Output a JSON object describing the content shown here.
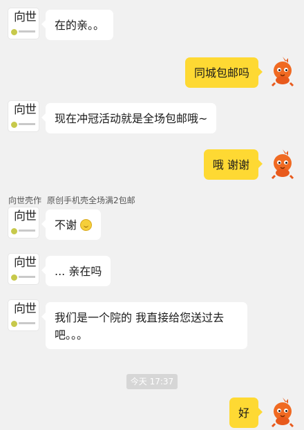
{
  "messages": [
    {
      "id": "m1",
      "side": "left",
      "text": "在的亲。。"
    },
    {
      "id": "m2",
      "side": "right",
      "text": "同城包邮吗"
    },
    {
      "id": "m3",
      "side": "left",
      "text": "现在冲冠活动就是全场包邮哦~"
    },
    {
      "id": "m4",
      "side": "right",
      "text": "哦 谢谢"
    },
    {
      "id": "m5",
      "side": "left",
      "text": "不谢"
    },
    {
      "id": "m6",
      "side": "left",
      "text": "... 亲在吗"
    },
    {
      "id": "m7",
      "side": "left",
      "line1": "我们是一个院的 我直接给您送过去",
      "line2": "吧。。。"
    },
    {
      "id": "m8",
      "side": "right",
      "text": "好"
    }
  ],
  "sender": {
    "name": "向世壳作",
    "tagline": "原创手机壳全场满2包邮"
  },
  "avatar": {
    "shop_glyph": "向世"
  },
  "timestamp": "今天 17:37",
  "colors": {
    "right_bubble": "#fed933",
    "left_bubble": "#ffffff",
    "background": "#f1f1f1"
  }
}
